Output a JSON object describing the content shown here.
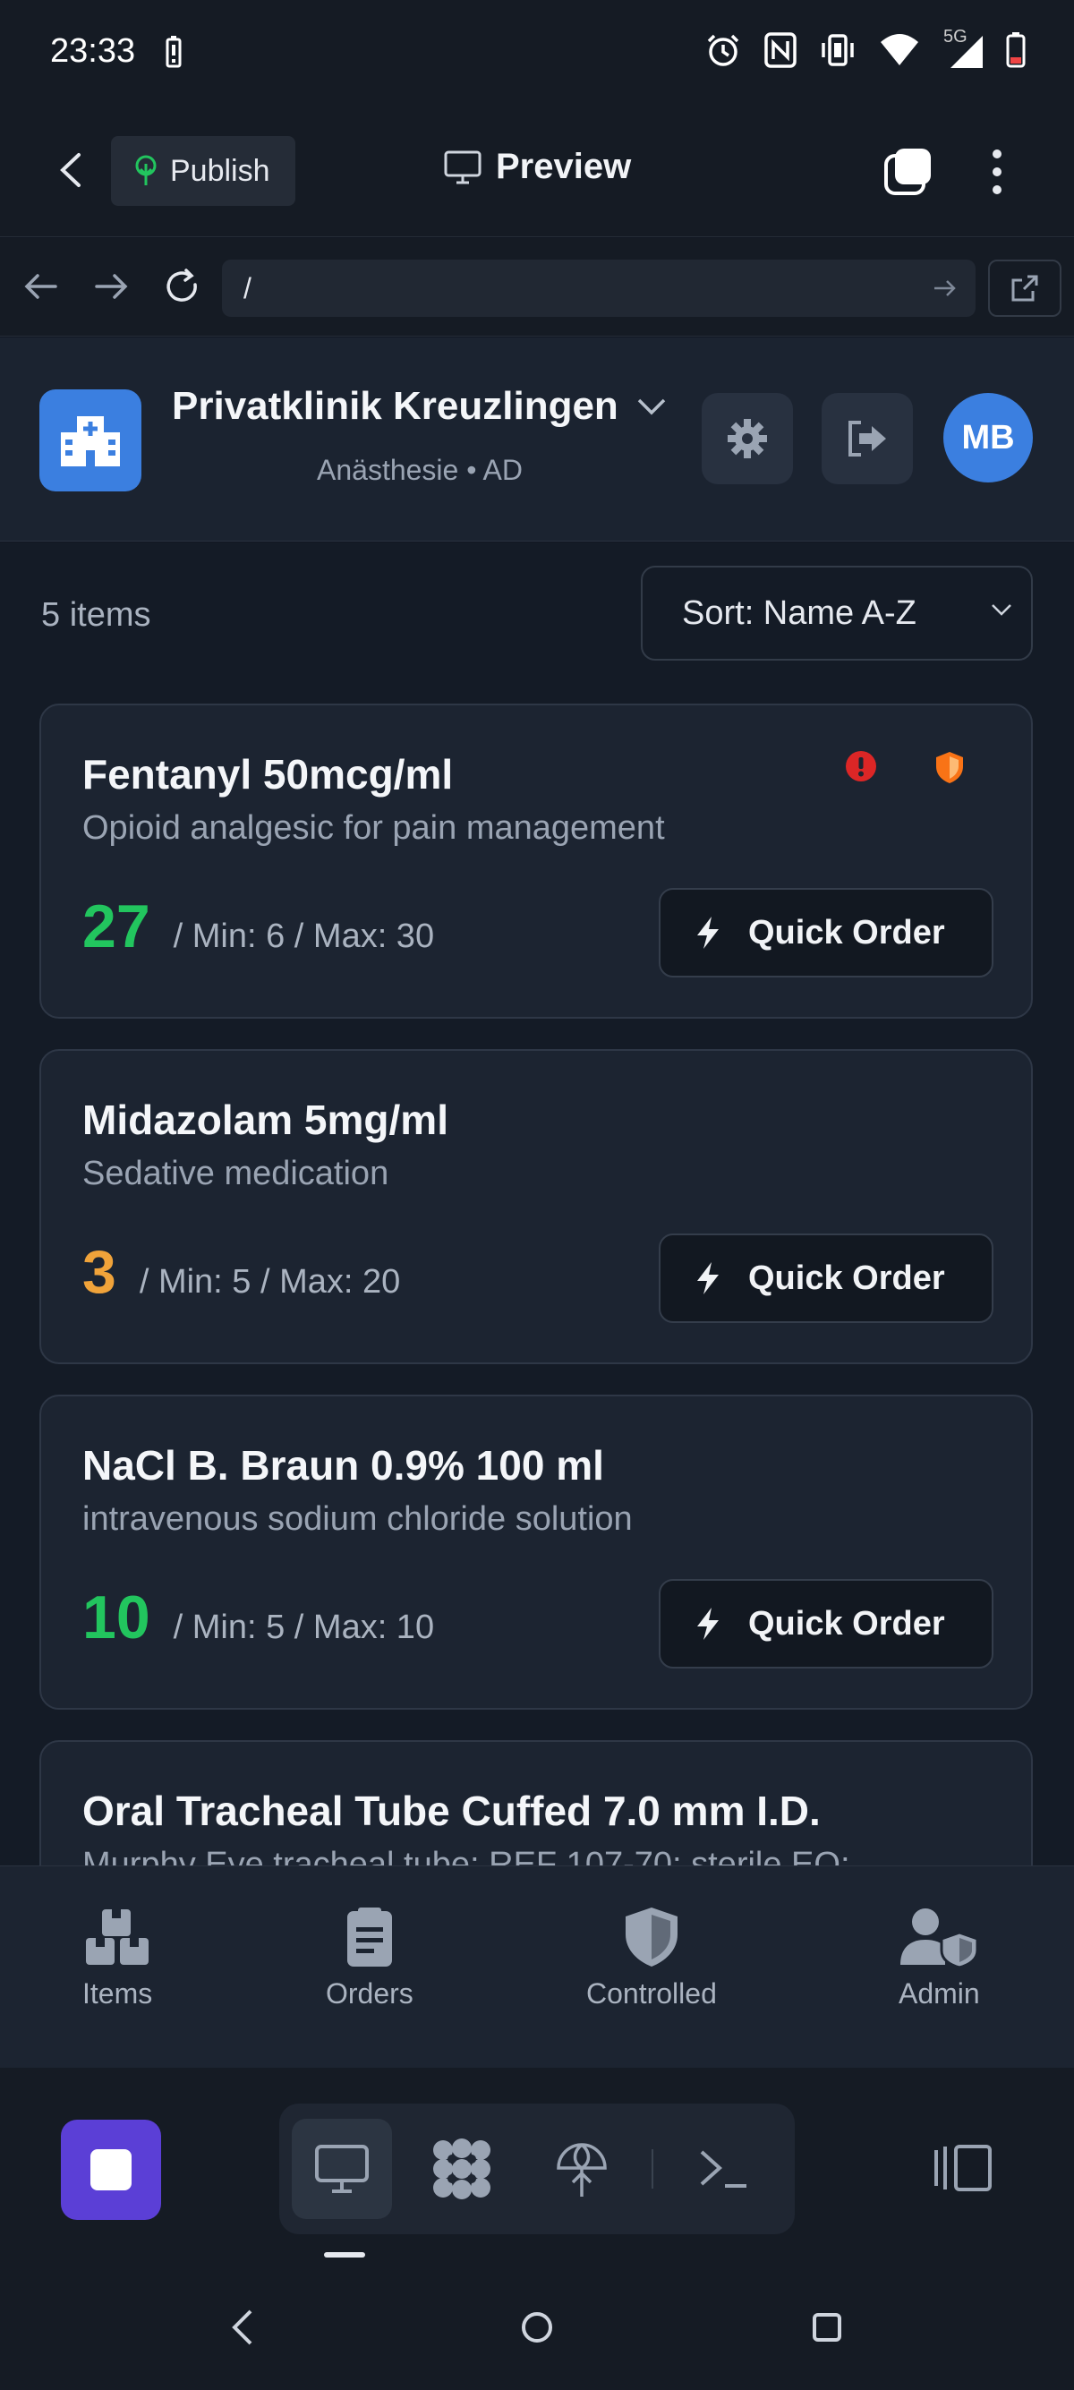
{
  "status_bar": {
    "time": "23:33",
    "network": "5G"
  },
  "app_bar": {
    "publish_label": "Publish",
    "preview_label": "Preview"
  },
  "url_bar": {
    "url": "/"
  },
  "clinic": {
    "name": "Privatklinik Kreuzlingen",
    "subtitle": "Anästhesie • AD",
    "avatar_initials": "MB",
    "accent": "#3b7fe0"
  },
  "list": {
    "count_label": "5 items",
    "sort_label": "Sort: Name A-Z",
    "quick_order_label": "Quick Order",
    "items": [
      {
        "name": "Fentanyl 50mcg/ml",
        "description": "Opioid analgesic for pain management",
        "stock": "27",
        "limits": "/ Min: 6 / Max: 30",
        "stock_color": "#22c55e",
        "flags": [
          "alert-icon",
          "shield-icon"
        ]
      },
      {
        "name": "Midazolam 5mg/ml",
        "description": "Sedative medication",
        "stock": "3",
        "limits": "/ Min: 5 / Max: 20",
        "stock_color": "#f0a33a",
        "flags": []
      },
      {
        "name": "NaCl B. Braun 0.9% 100 ml",
        "description": "intravenous sodium chloride solution",
        "stock": "10",
        "limits": "/ Min: 5 / Max: 10",
        "stock_color": "#22c55e",
        "flags": []
      },
      {
        "name": "Oral Tracheal Tube Cuffed 7.0 mm I.D.",
        "description": "Murphy Eye tracheal tube; REF 107-70; sterile EO;",
        "stock": "",
        "limits": "",
        "stock_color": "#22c55e",
        "flags": []
      }
    ]
  },
  "bottom_nav": {
    "items": [
      {
        "label": "Items",
        "icon": "boxes-icon"
      },
      {
        "label": "Orders",
        "icon": "clipboard-icon"
      },
      {
        "label": "Controlled",
        "icon": "shield-icon"
      },
      {
        "label": "Admin",
        "icon": "user-shield-icon"
      }
    ]
  },
  "colors": {
    "background": "#111722",
    "card": "#1c2431",
    "alert": "#dc2626",
    "controlled": "#f97316",
    "ide_accent": "#5b3fd6"
  }
}
